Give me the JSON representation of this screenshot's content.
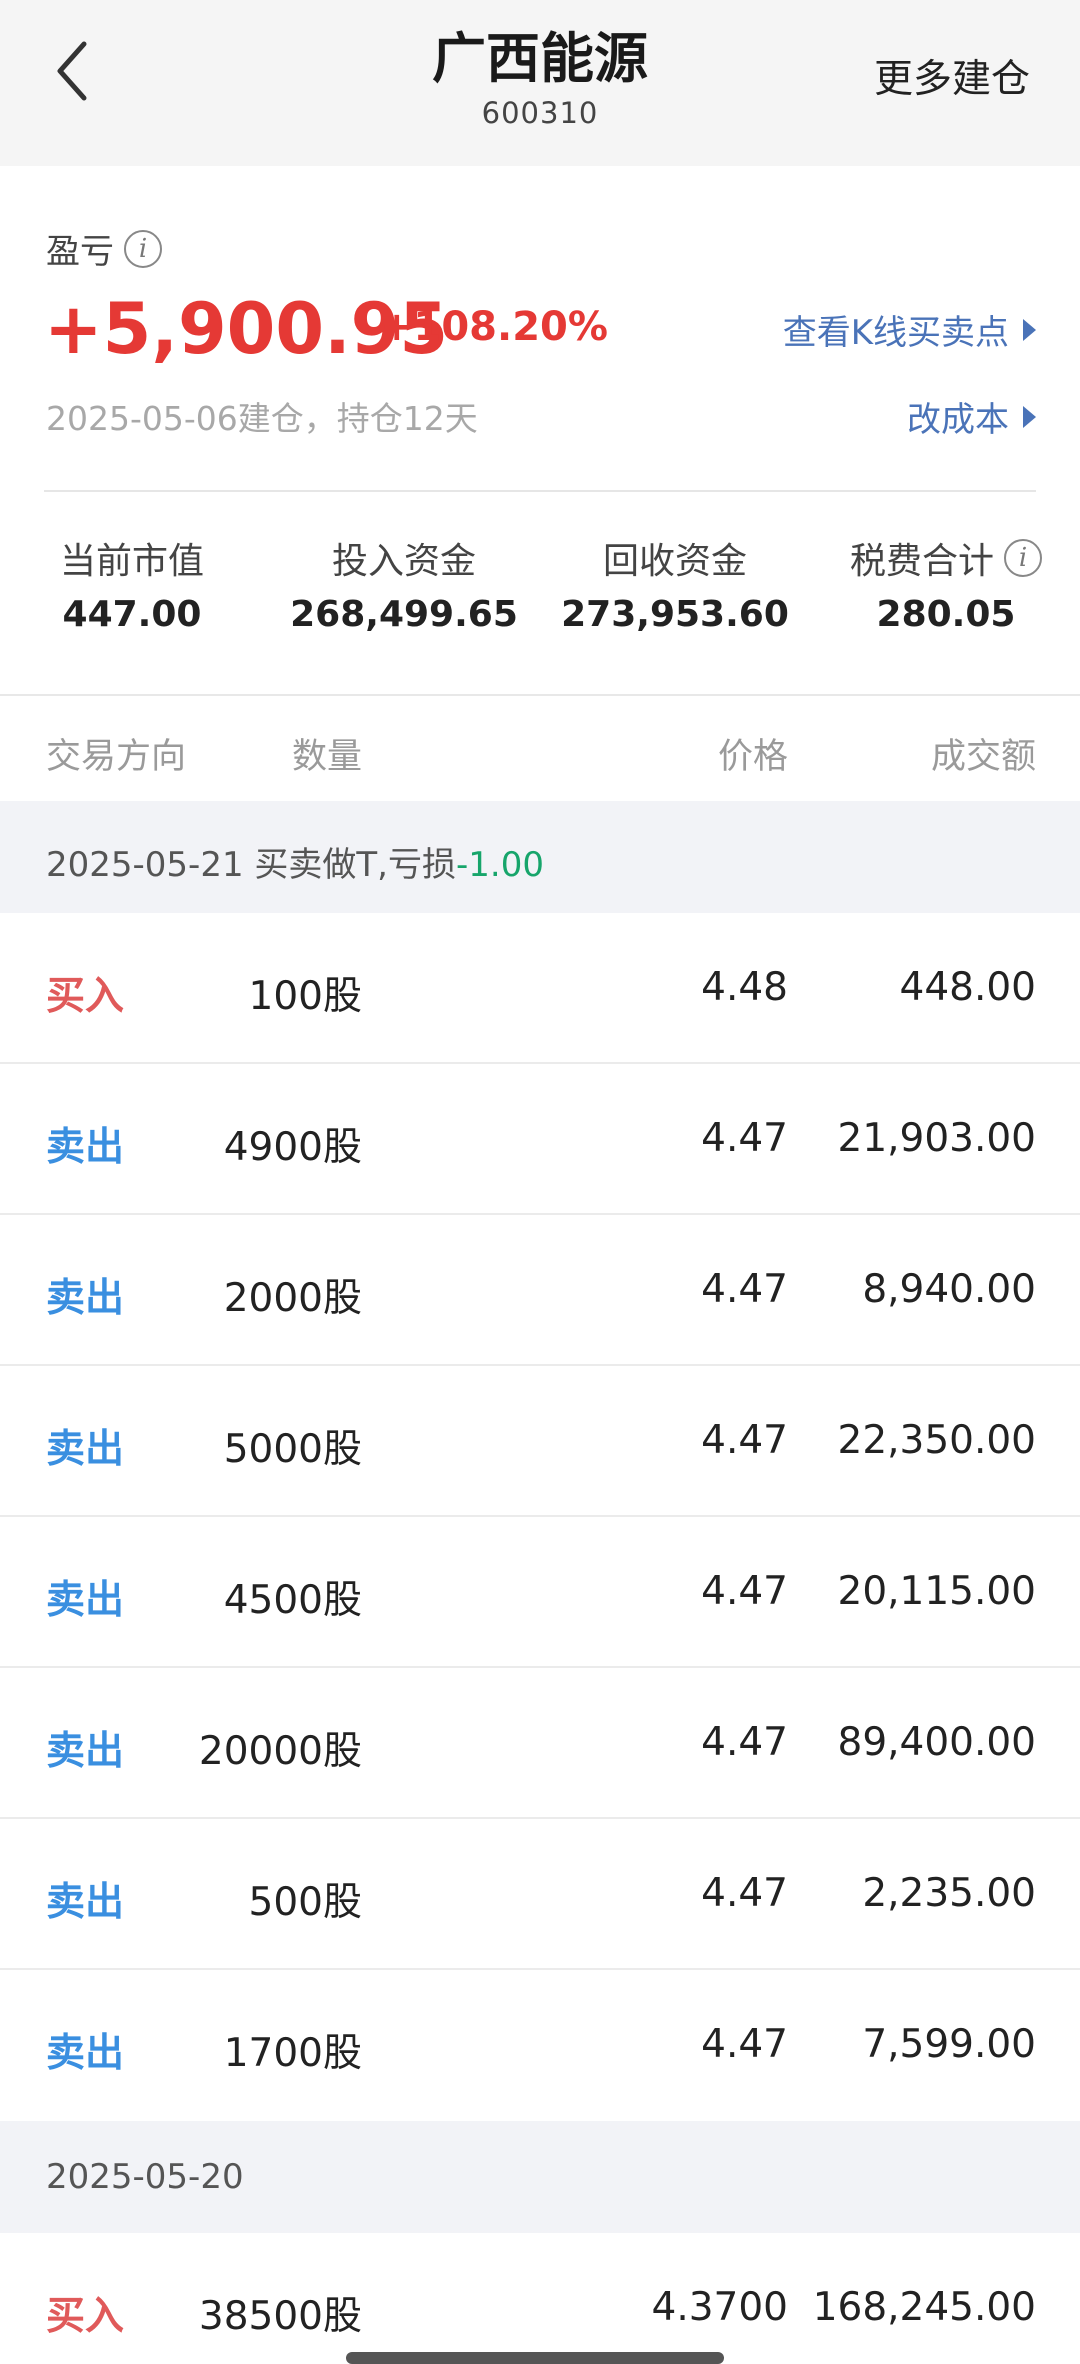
{
  "header": {
    "title": "广西能源",
    "code": "600310",
    "more_label": "更多建仓"
  },
  "summary": {
    "pnl_label": "盈亏",
    "pnl_value": "+5,900.95",
    "pnl_pct": "+108.20%",
    "subtitle": "2025-05-06建仓，持仓12天",
    "kline_link": "查看K线买卖点",
    "cost_link": "改成本"
  },
  "stats": [
    {
      "label": "当前市值",
      "value": "447.00"
    },
    {
      "label": "投入资金",
      "value": "268,499.65"
    },
    {
      "label": "回收资金",
      "value": "273,953.60"
    },
    {
      "label": "税费合计",
      "value": "280.05"
    }
  ],
  "table": {
    "columns": [
      "交易方向",
      "数量",
      "价格",
      "成交额"
    ],
    "groups": [
      {
        "title": "2025-05-21 买卖做T,亏损",
        "loss": "-1.00",
        "rows": [
          {
            "dir": "买入",
            "qty": "100股",
            "price": "4.48",
            "amount": "448.00"
          },
          {
            "dir": "卖出",
            "qty": "4900股",
            "price": "4.47",
            "amount": "21,903.00"
          },
          {
            "dir": "卖出",
            "qty": "2000股",
            "price": "4.47",
            "amount": "8,940.00"
          },
          {
            "dir": "卖出",
            "qty": "5000股",
            "price": "4.47",
            "amount": "22,350.00"
          },
          {
            "dir": "卖出",
            "qty": "4500股",
            "price": "4.47",
            "amount": "20,115.00"
          },
          {
            "dir": "卖出",
            "qty": "20000股",
            "price": "4.47",
            "amount": "89,400.00"
          },
          {
            "dir": "卖出",
            "qty": "500股",
            "price": "4.47",
            "amount": "2,235.00"
          },
          {
            "dir": "卖出",
            "qty": "1700股",
            "price": "4.47",
            "amount": "7,599.00"
          }
        ]
      },
      {
        "title": "2025-05-20",
        "rows": [
          {
            "dir": "买入",
            "qty": "38500股",
            "price": "4.3700",
            "amount": "168,245.00"
          }
        ]
      }
    ]
  },
  "colors": {
    "profit_red": "#e53935",
    "buy_red": "#e05a5a",
    "sell_blue": "#3a8fe0",
    "link_blue": "#4a73b8",
    "loss_green": "#17a56b"
  },
  "icons": {
    "back": "chevron-left-icon",
    "info": "info-icon",
    "link_arrow": "triangle-right-icon"
  }
}
